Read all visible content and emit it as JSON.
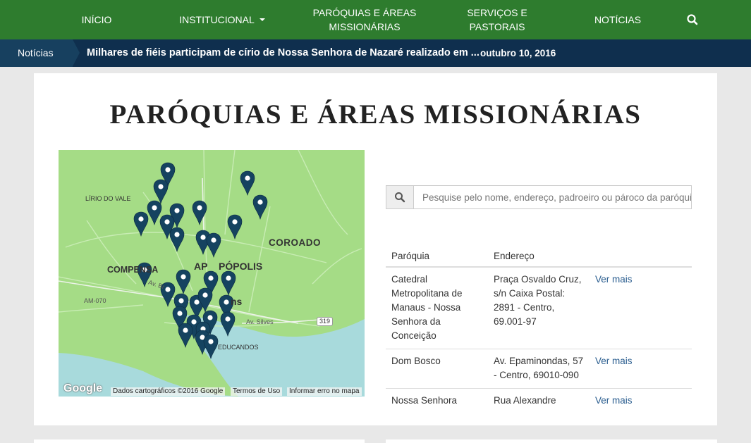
{
  "nav": {
    "items": [
      {
        "label": "INÍCIO"
      },
      {
        "label": "INSTITUCIONAL"
      },
      {
        "label": "PARÓQUIAS E ÁREAS MISSIONÁRIAS"
      },
      {
        "label": "SERVIÇOS E PASTORAIS"
      },
      {
        "label": "NOTÍCIAS"
      }
    ],
    "search_icon": "search-icon"
  },
  "ticker": {
    "label": "Notícias",
    "headline": "Milhares de fiéis participam de círio de Nossa Senhora de Nazaré realizado em ...",
    "date": "outubro 10, 2016"
  },
  "page": {
    "title": "PARÓQUIAS E ÁREAS MISSIONÁRIAS"
  },
  "map": {
    "labels": {
      "lirio": "LÍRIO DO VALE",
      "coroado": "COROADO",
      "compensa": "COMPENSA",
      "polis": "AP    PÓPOLIS",
      "am070": "AM-070",
      "av_br": "Av. Br",
      "manaus_frag": "ns",
      "av_silves": "Av. Silves",
      "r319": "319",
      "educandos": "EDUCANDOS"
    },
    "google": "Google",
    "credits": {
      "data": "Dados cartográficos ©2016 Google",
      "terms": "Termos de Uso",
      "report": "Informar erro no mapa"
    },
    "marker_color": "#154360",
    "land_color": "#a5dc86"
  },
  "search": {
    "placeholder": "Pesquise pelo nome, endereço, padroeiro ou pároco da paróquia"
  },
  "table": {
    "headers": {
      "parish": "Paróquia",
      "address": "Endereço"
    },
    "rows": [
      {
        "parish": "Catedral Metropolitana de Manaus - Nossa Senhora da Conceição",
        "address": "Praça Osvaldo Cruz, s/n Caixa Postal: 2891 - Centro, 69.001-97",
        "link": "Ver mais"
      },
      {
        "parish": "Dom Bosco",
        "address": "Av. Epaminondas, 57 - Centro, 69010-090",
        "link": "Ver mais"
      },
      {
        "parish": "Nossa Senhora",
        "address": "Rua Alexandre",
        "link": "Ver mais"
      }
    ]
  }
}
